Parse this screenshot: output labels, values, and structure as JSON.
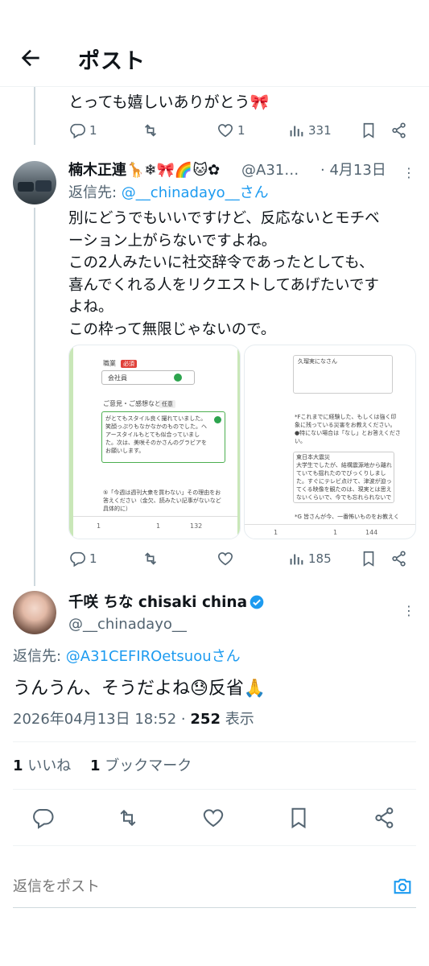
{
  "header": {
    "title": "ポスト"
  },
  "prev_tweet": {
    "text": "とっても嬉しいありがとう🎀",
    "replies": "1",
    "likes": "1",
    "views": "331"
  },
  "reply_tweet": {
    "name": "楠木正連🦒❄🎀🌈🐱✿",
    "handle": "@A31…",
    "date": "· 4月13日",
    "reply_to_prefix": "返信先: ",
    "reply_to_handle": "@__chinadayo__さん",
    "lines": [
      "別にどうでもいいですけど、反応ないとモチベ",
      "ーション上がらないですよね。",
      "この2人みたいに社交辞令であったとしても、",
      "喜んでくれる人をリクエストしてあげたいです",
      "よね。",
      "この枠って無限じゃないので。"
    ],
    "replies": "1",
    "views": "185",
    "left_image": {
      "field_label": "職業",
      "required_badge": "必須",
      "select_value": "会社員",
      "opinion_label": "ご意見・ご感想など",
      "optional_badge": "任意",
      "opinion_lines": [
        "がとてもスタイル良く撮れていました。",
        "笑顔っぷりもなかなかのものでした。ヘ",
        "アースタイルもとても似合っていまし",
        "た。次は、美咲そのかさんのグラビアを",
        "お願いします。"
      ],
      "q5_lines": [
        "⑤「今週は週刊大衆を買わない」その理由をお",
        "答えください（金欠、読みたい記事がないなど",
        "具体的に）"
      ],
      "stats": {
        "replies": "1",
        "likes": "1",
        "views": "132"
      }
    },
    "right_image": {
      "input_value": "久瑠実になさん",
      "q_lines": [
        "*Fこれまでに経験した、もしくは強く印",
        "象に残っている災害をお教えください。",
        "●特にない場合は「なし」とお答えくださ",
        "い。"
      ],
      "answer_lines": [
        "東日本大震災",
        "大学生でしたが、結構震源地から離れ",
        "ていても揺れたのでびっくりしまし",
        "た。すぐにテレビ点けて、津波が迫っ",
        "てくる映像を観たのは、現実とは思え",
        "ないくらいで、今でも忘れられないで"
      ],
      "g_line": "*G 皆さんが今、一番怖いものをお教えく",
      "stats": {
        "replies": "1",
        "likes": "1",
        "views": "144"
      }
    }
  },
  "main_tweet": {
    "name": "千咲 ちな chisaki china",
    "handle": "@__chinadayo__",
    "reply_to_prefix": "返信先: ",
    "reply_to_handle": "@A31CEFIROetsuouさん",
    "text": "うんうん、そうだよね😓反省🙏",
    "timestamp": "2026年04月13日 18:52 · ",
    "views_count": "252",
    "views_label": " 表示",
    "likes_count": "1",
    "likes_label": " いいね",
    "bookmarks_count": "1",
    "bookmarks_label": " ブックマーク"
  },
  "reply_input": {
    "placeholder": "返信をポスト"
  },
  "colors": {
    "accent": "#1d9bf0",
    "muted": "#536471",
    "text": "#0f1419",
    "divider": "#eff3f4"
  }
}
